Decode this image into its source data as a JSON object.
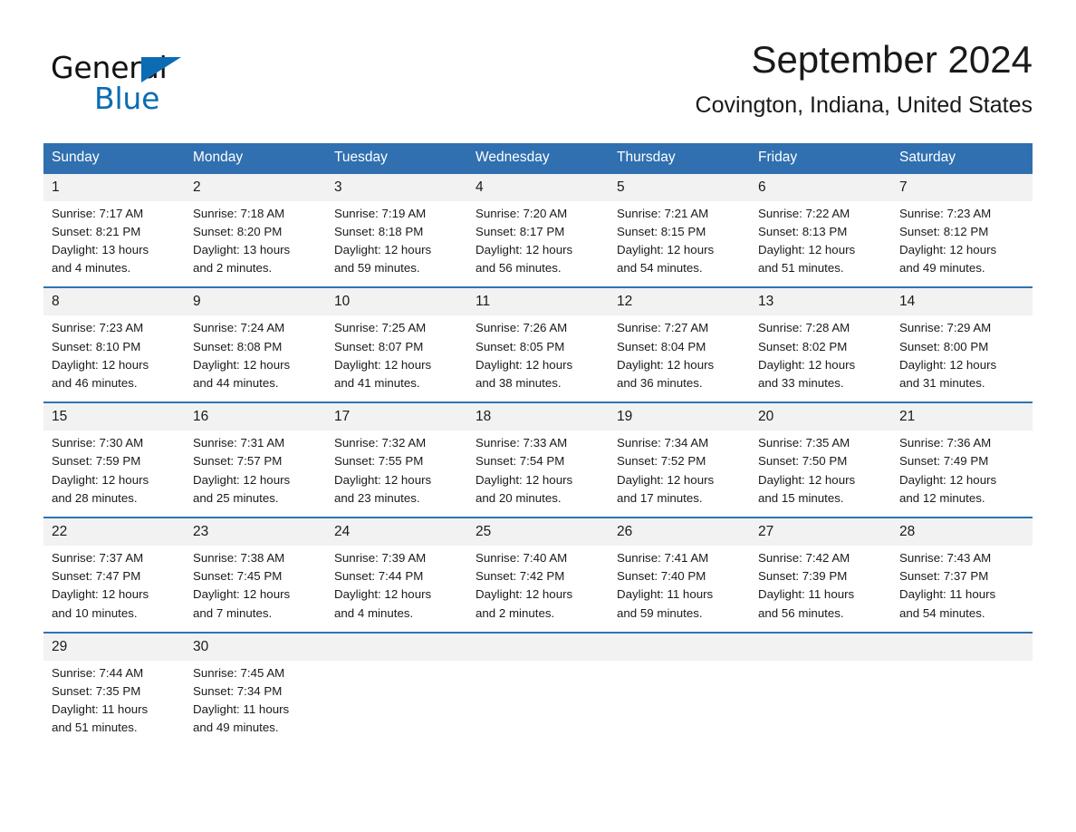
{
  "brand": {
    "name_part1": "General",
    "name_part2": "Blue",
    "logo_icon": "triangle-icon",
    "accent_color": "#0b6cb3"
  },
  "header": {
    "title": "September 2024",
    "subtitle": "Covington, Indiana, United States"
  },
  "theme": {
    "header_blue": "#3070B0",
    "separator_blue": "#2E74B5",
    "daynum_band": "#F2F2F2"
  },
  "calendar": {
    "weekday_headers": [
      "Sunday",
      "Monday",
      "Tuesday",
      "Wednesday",
      "Thursday",
      "Friday",
      "Saturday"
    ],
    "weeks": [
      {
        "days": [
          {
            "num": "1",
            "sunrise": "Sunrise: 7:17 AM",
            "sunset": "Sunset: 8:21 PM",
            "daylight1": "Daylight: 13 hours",
            "daylight2": "and 4 minutes."
          },
          {
            "num": "2",
            "sunrise": "Sunrise: 7:18 AM",
            "sunset": "Sunset: 8:20 PM",
            "daylight1": "Daylight: 13 hours",
            "daylight2": "and 2 minutes."
          },
          {
            "num": "3",
            "sunrise": "Sunrise: 7:19 AM",
            "sunset": "Sunset: 8:18 PM",
            "daylight1": "Daylight: 12 hours",
            "daylight2": "and 59 minutes."
          },
          {
            "num": "4",
            "sunrise": "Sunrise: 7:20 AM",
            "sunset": "Sunset: 8:17 PM",
            "daylight1": "Daylight: 12 hours",
            "daylight2": "and 56 minutes."
          },
          {
            "num": "5",
            "sunrise": "Sunrise: 7:21 AM",
            "sunset": "Sunset: 8:15 PM",
            "daylight1": "Daylight: 12 hours",
            "daylight2": "and 54 minutes."
          },
          {
            "num": "6",
            "sunrise": "Sunrise: 7:22 AM",
            "sunset": "Sunset: 8:13 PM",
            "daylight1": "Daylight: 12 hours",
            "daylight2": "and 51 minutes."
          },
          {
            "num": "7",
            "sunrise": "Sunrise: 7:23 AM",
            "sunset": "Sunset: 8:12 PM",
            "daylight1": "Daylight: 12 hours",
            "daylight2": "and 49 minutes."
          }
        ]
      },
      {
        "days": [
          {
            "num": "8",
            "sunrise": "Sunrise: 7:23 AM",
            "sunset": "Sunset: 8:10 PM",
            "daylight1": "Daylight: 12 hours",
            "daylight2": "and 46 minutes."
          },
          {
            "num": "9",
            "sunrise": "Sunrise: 7:24 AM",
            "sunset": "Sunset: 8:08 PM",
            "daylight1": "Daylight: 12 hours",
            "daylight2": "and 44 minutes."
          },
          {
            "num": "10",
            "sunrise": "Sunrise: 7:25 AM",
            "sunset": "Sunset: 8:07 PM",
            "daylight1": "Daylight: 12 hours",
            "daylight2": "and 41 minutes."
          },
          {
            "num": "11",
            "sunrise": "Sunrise: 7:26 AM",
            "sunset": "Sunset: 8:05 PM",
            "daylight1": "Daylight: 12 hours",
            "daylight2": "and 38 minutes."
          },
          {
            "num": "12",
            "sunrise": "Sunrise: 7:27 AM",
            "sunset": "Sunset: 8:04 PM",
            "daylight1": "Daylight: 12 hours",
            "daylight2": "and 36 minutes."
          },
          {
            "num": "13",
            "sunrise": "Sunrise: 7:28 AM",
            "sunset": "Sunset: 8:02 PM",
            "daylight1": "Daylight: 12 hours",
            "daylight2": "and 33 minutes."
          },
          {
            "num": "14",
            "sunrise": "Sunrise: 7:29 AM",
            "sunset": "Sunset: 8:00 PM",
            "daylight1": "Daylight: 12 hours",
            "daylight2": "and 31 minutes."
          }
        ]
      },
      {
        "days": [
          {
            "num": "15",
            "sunrise": "Sunrise: 7:30 AM",
            "sunset": "Sunset: 7:59 PM",
            "daylight1": "Daylight: 12 hours",
            "daylight2": "and 28 minutes."
          },
          {
            "num": "16",
            "sunrise": "Sunrise: 7:31 AM",
            "sunset": "Sunset: 7:57 PM",
            "daylight1": "Daylight: 12 hours",
            "daylight2": "and 25 minutes."
          },
          {
            "num": "17",
            "sunrise": "Sunrise: 7:32 AM",
            "sunset": "Sunset: 7:55 PM",
            "daylight1": "Daylight: 12 hours",
            "daylight2": "and 23 minutes."
          },
          {
            "num": "18",
            "sunrise": "Sunrise: 7:33 AM",
            "sunset": "Sunset: 7:54 PM",
            "daylight1": "Daylight: 12 hours",
            "daylight2": "and 20 minutes."
          },
          {
            "num": "19",
            "sunrise": "Sunrise: 7:34 AM",
            "sunset": "Sunset: 7:52 PM",
            "daylight1": "Daylight: 12 hours",
            "daylight2": "and 17 minutes."
          },
          {
            "num": "20",
            "sunrise": "Sunrise: 7:35 AM",
            "sunset": "Sunset: 7:50 PM",
            "daylight1": "Daylight: 12 hours",
            "daylight2": "and 15 minutes."
          },
          {
            "num": "21",
            "sunrise": "Sunrise: 7:36 AM",
            "sunset": "Sunset: 7:49 PM",
            "daylight1": "Daylight: 12 hours",
            "daylight2": "and 12 minutes."
          }
        ]
      },
      {
        "days": [
          {
            "num": "22",
            "sunrise": "Sunrise: 7:37 AM",
            "sunset": "Sunset: 7:47 PM",
            "daylight1": "Daylight: 12 hours",
            "daylight2": "and 10 minutes."
          },
          {
            "num": "23",
            "sunrise": "Sunrise: 7:38 AM",
            "sunset": "Sunset: 7:45 PM",
            "daylight1": "Daylight: 12 hours",
            "daylight2": "and 7 minutes."
          },
          {
            "num": "24",
            "sunrise": "Sunrise: 7:39 AM",
            "sunset": "Sunset: 7:44 PM",
            "daylight1": "Daylight: 12 hours",
            "daylight2": "and 4 minutes."
          },
          {
            "num": "25",
            "sunrise": "Sunrise: 7:40 AM",
            "sunset": "Sunset: 7:42 PM",
            "daylight1": "Daylight: 12 hours",
            "daylight2": "and 2 minutes."
          },
          {
            "num": "26",
            "sunrise": "Sunrise: 7:41 AM",
            "sunset": "Sunset: 7:40 PM",
            "daylight1": "Daylight: 11 hours",
            "daylight2": "and 59 minutes."
          },
          {
            "num": "27",
            "sunrise": "Sunrise: 7:42 AM",
            "sunset": "Sunset: 7:39 PM",
            "daylight1": "Daylight: 11 hours",
            "daylight2": "and 56 minutes."
          },
          {
            "num": "28",
            "sunrise": "Sunrise: 7:43 AM",
            "sunset": "Sunset: 7:37 PM",
            "daylight1": "Daylight: 11 hours",
            "daylight2": "and 54 minutes."
          }
        ]
      },
      {
        "days": [
          {
            "num": "29",
            "sunrise": "Sunrise: 7:44 AM",
            "sunset": "Sunset: 7:35 PM",
            "daylight1": "Daylight: 11 hours",
            "daylight2": "and 51 minutes."
          },
          {
            "num": "30",
            "sunrise": "Sunrise: 7:45 AM",
            "sunset": "Sunset: 7:34 PM",
            "daylight1": "Daylight: 11 hours",
            "daylight2": "and 49 minutes."
          },
          {
            "num": "",
            "sunrise": "",
            "sunset": "",
            "daylight1": "",
            "daylight2": ""
          },
          {
            "num": "",
            "sunrise": "",
            "sunset": "",
            "daylight1": "",
            "daylight2": ""
          },
          {
            "num": "",
            "sunrise": "",
            "sunset": "",
            "daylight1": "",
            "daylight2": ""
          },
          {
            "num": "",
            "sunrise": "",
            "sunset": "",
            "daylight1": "",
            "daylight2": ""
          },
          {
            "num": "",
            "sunrise": "",
            "sunset": "",
            "daylight1": "",
            "daylight2": ""
          }
        ]
      }
    ]
  }
}
